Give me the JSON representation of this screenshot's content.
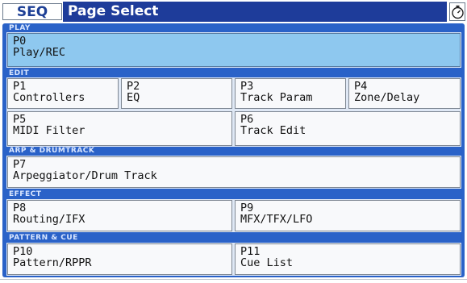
{
  "header": {
    "mode": "SEQ",
    "title": "Page Select",
    "timer_icon": "stopwatch-icon"
  },
  "sections": [
    {
      "label": "PLAY",
      "pages": [
        {
          "number": "P0",
          "name": "Play/REC",
          "active": true
        }
      ]
    },
    {
      "label": "EDIT",
      "pages": [
        {
          "number": "P1",
          "name": "Controllers"
        },
        {
          "number": "P2",
          "name": "EQ"
        },
        {
          "number": "P3",
          "name": "Track Param"
        },
        {
          "number": "P4",
          "name": "Zone/Delay"
        },
        {
          "number": "P5",
          "name": "MIDI Filter"
        },
        {
          "number": "P6",
          "name": "Track Edit"
        }
      ]
    },
    {
      "label": "ARP & DRUMTRACK",
      "pages": [
        {
          "number": "P7",
          "name": "Arpeggiator/Drum Track"
        }
      ]
    },
    {
      "label": "EFFECT",
      "pages": [
        {
          "number": "P8",
          "name": "Routing/IFX"
        },
        {
          "number": "P9",
          "name": "MFX/TFX/LFO"
        }
      ]
    },
    {
      "label": "PATTERN & CUE",
      "pages": [
        {
          "number": "P10",
          "name": "Pattern/RPPR"
        },
        {
          "number": "P11",
          "name": "Cue List"
        }
      ]
    }
  ],
  "colors": {
    "title_bar": "#1e3c9a",
    "panel": "#2a62c8",
    "active_button": "#8ec8ef",
    "button": "#f8f9fb"
  }
}
